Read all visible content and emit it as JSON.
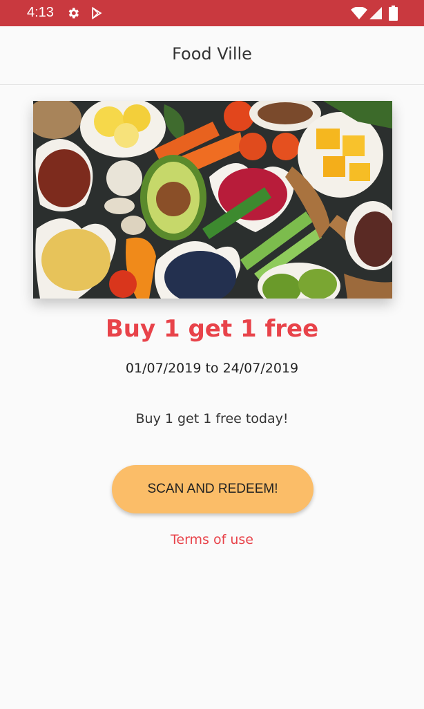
{
  "status_bar": {
    "time": "4:13",
    "icons": [
      "gear-icon",
      "play-store-icon",
      "wifi-icon",
      "signal-icon",
      "battery-icon"
    ],
    "color": "#c9393f"
  },
  "app_bar": {
    "title": "Food Ville"
  },
  "promo": {
    "image": "assorted healthy foods in heart-shaped bowls",
    "title": "Buy 1 get 1 free",
    "dates": "01/07/2019 to 24/07/2019",
    "description": "Buy 1 get 1 free today!",
    "redeem_label": "SCAN AND REDEEM!",
    "terms_label": "Terms of use",
    "accent_color": "#e8434a",
    "button_color": "#fbbd68"
  }
}
